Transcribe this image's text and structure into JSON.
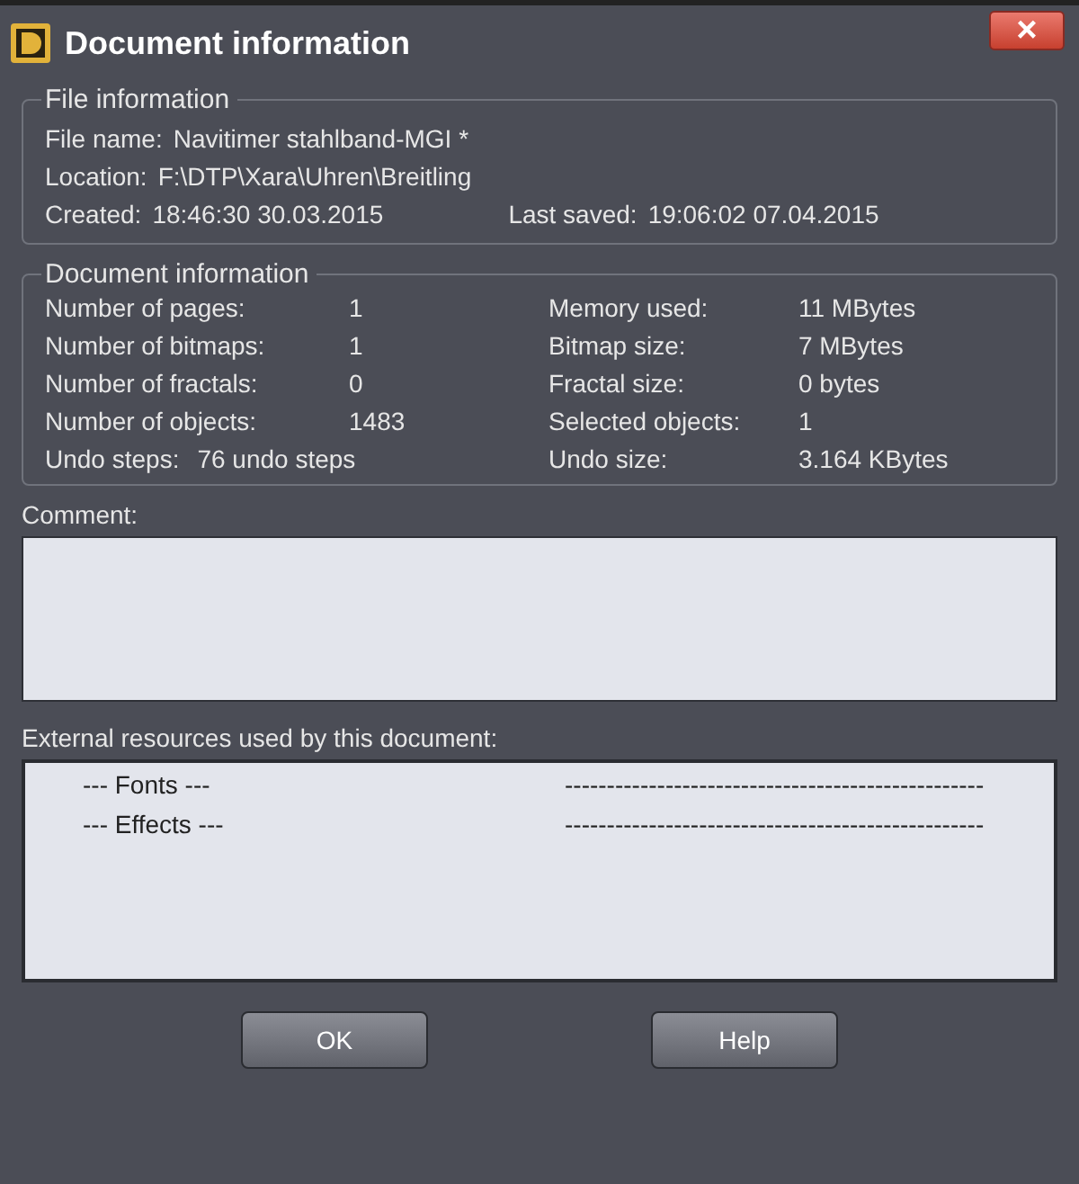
{
  "window": {
    "title": "Document information",
    "close": "×"
  },
  "file_information": {
    "legend": "File information",
    "file_name": {
      "label": "File name:",
      "value": "Navitimer stahlband-MGI *"
    },
    "location": {
      "label": "Location:",
      "value": "F:\\DTP\\Xara\\Uhren\\Breitling"
    },
    "created": {
      "label": "Created:",
      "value": "18:46:30  30.03.2015"
    },
    "last_saved": {
      "label": "Last saved:",
      "value": "19:06:02  07.04.2015"
    }
  },
  "document_information": {
    "legend": "Document information",
    "rows": [
      {
        "left_label": "Number of pages:",
        "left_value": "1",
        "right_label": "Memory used:",
        "right_value": "11 MBytes"
      },
      {
        "left_label": "Number of bitmaps:",
        "left_value": "1",
        "right_label": "Bitmap size:",
        "right_value": "7 MBytes"
      },
      {
        "left_label": "Number of fractals:",
        "left_value": "0",
        "right_label": "Fractal size:",
        "right_value": "0 bytes"
      },
      {
        "left_label": "Number of objects:",
        "left_value": "1483",
        "right_label": "Selected objects:",
        "right_value": "1"
      },
      {
        "left_label": "Undo steps:",
        "left_value": "76 undo steps",
        "right_label": "Undo size:",
        "right_value": "3.164 KBytes"
      }
    ]
  },
  "comment": {
    "label": "Comment:"
  },
  "external_resources": {
    "label": "External resources used by this document:",
    "rows": [
      {
        "name": "--- Fonts ---",
        "column_2": "--------------------------------------------------"
      },
      {
        "name": "--- Effects ---",
        "column_2": "--------------------------------------------------"
      }
    ]
  },
  "buttons": [
    "OK",
    "Help"
  ]
}
